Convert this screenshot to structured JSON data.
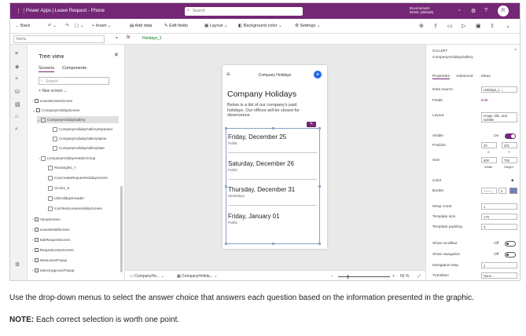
{
  "titlebar": {
    "app_name": "Power Apps | Leave Request - Phone",
    "search_placeholder": "Search",
    "environment_line1": "Environment",
    "environment_line2": "MUSL (default)",
    "avatar_initials": "R"
  },
  "toolbar": {
    "back": "Back",
    "insert": "Insert",
    "add_data": "Add data",
    "edit_fields": "Edit fields",
    "layout": "Layout",
    "background_color": "Background color",
    "settings": "Settings"
  },
  "formula_bar": {
    "property": "Items",
    "equals": "=",
    "fx": "fx",
    "value": "Holidays_1"
  },
  "tree": {
    "title": "Tree view",
    "tabs": [
      "Screens",
      "Components"
    ],
    "search_placeholder": "Search",
    "new_screen": "New screen",
    "nodes": [
      "LeaveBrowseScreen",
      "CompanyHolidayScreen",
      "CompanyHolidayGallery",
      "CompanyHolidayGallerySeparator",
      "CompanyHolidayGalleryName",
      "CompanyHolidayGalleryDate",
      "CompanyHolidayHeaderGroup",
      "Rectangle1_7",
      "IconCreateRequestHolidayScreen",
      "Circle1_5",
      "LblHolidaysHeader",
      "IconTeamLeaveHolidayScreen",
      "AboutScreen",
      "LeaveDetailScreen",
      "EditRequestScreen",
      "RequestLeaveScreen",
      "NewLeavePopup",
      "SelectApproverPopup"
    ]
  },
  "phone": {
    "app_title": "Company Holidays",
    "page_title": "Company Holidays",
    "description": "Below is a list of our company's paid holidays. Our offices will be closed for observance.",
    "holidays": [
      {
        "date": "Friday, December 25",
        "type": "Public"
      },
      {
        "date": "Saturday, December 26",
        "type": "Public"
      },
      {
        "date": "Thursday, December 31",
        "type": "Weekdays"
      },
      {
        "date": "Friday, January 01",
        "type": "Public"
      }
    ]
  },
  "status": {
    "screen_crumb": "CompanyHo...",
    "control_crumb": "CompanyHolida...",
    "zoom": "65 %"
  },
  "properties": {
    "type": "GALLERY",
    "control_name": "CompanyHolidayGallery",
    "tabs": [
      "Properties",
      "Advanced",
      "Ideas"
    ],
    "data_source_label": "Data source",
    "data_source_value": "Holidays_1",
    "fields_label": "Fields",
    "fields_value": "Edit",
    "layout_label": "Layout",
    "layout_value": "Image, title, and subtitle",
    "visible_label": "Visible",
    "visible_state": "On",
    "position_label": "Position",
    "position_x": "20",
    "position_y": "201",
    "x_label": "X",
    "y_label": "Y",
    "size_label": "Size",
    "size_w": "600",
    "size_h": "755",
    "width_label": "Width",
    "height_label": "Height",
    "color_label": "Color",
    "border_label": "Border",
    "border_value": "0",
    "wrap_label": "Wrap count",
    "wrap_value": "1",
    "template_size_label": "Template size",
    "template_size_value": "170",
    "template_padding_label": "Template padding",
    "template_padding_value": "0",
    "show_scrollbar_label": "Show scrollbar",
    "show_scrollbar_state": "Off",
    "show_navigation_label": "Show navigation",
    "show_navigation_state": "Off",
    "navigation_step_label": "Navigation step",
    "navigation_step_value": "1",
    "transition_label": "Transition",
    "transition_value": "None"
  },
  "question": {
    "instruction": "Use the drop-down menus to select the answer choice that answers each question based on the information presented in the graphic.",
    "note_label": "NOTE:",
    "note_text": " Each correct selection is worth one point."
  },
  "colors": {
    "brand": "#742774",
    "accent_blue": "#2266e3"
  }
}
